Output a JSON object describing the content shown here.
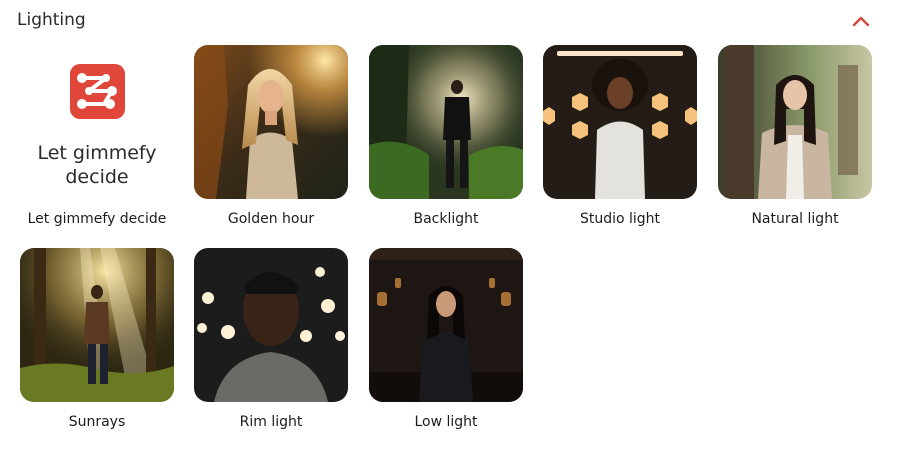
{
  "section": {
    "title": "Lighting",
    "collapse_icon": "chevron-up-icon",
    "accent_color": "#e0463a"
  },
  "options": [
    {
      "id": "auto",
      "label": "Let gimmefy decide",
      "thumb_text": "Let gimmefy decide",
      "icon": "gimmefy-logo-icon"
    },
    {
      "id": "golden-hour",
      "label": "Golden hour"
    },
    {
      "id": "backlight",
      "label": "Backlight"
    },
    {
      "id": "studio-light",
      "label": "Studio light"
    },
    {
      "id": "natural-light",
      "label": "Natural light"
    },
    {
      "id": "sunrays",
      "label": "Sunrays"
    },
    {
      "id": "rim-light",
      "label": "Rim light"
    },
    {
      "id": "low-light",
      "label": "Low light"
    }
  ]
}
